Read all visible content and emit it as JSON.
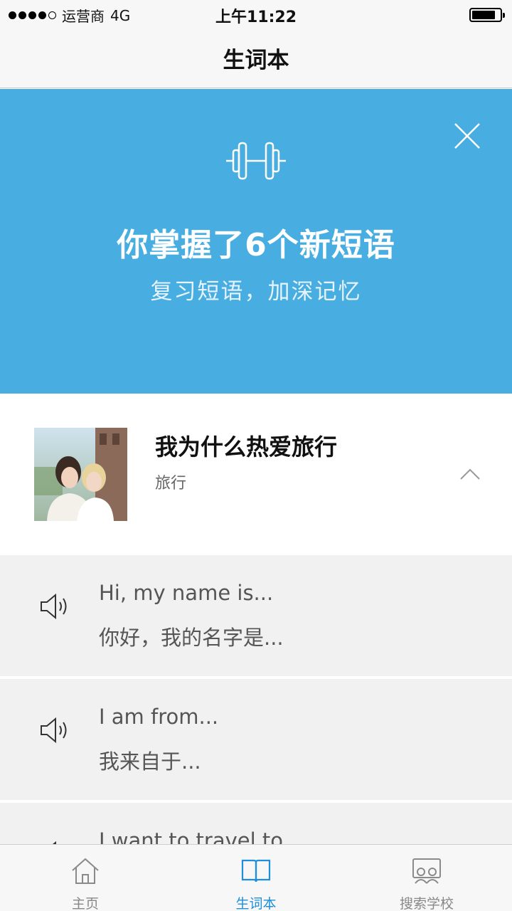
{
  "status_bar": {
    "carrier": "运营商",
    "network": "4G",
    "time": "上午11:22",
    "signal_bars": 4,
    "battery_level": 0.85
  },
  "nav": {
    "title": "生词本"
  },
  "banner": {
    "icon": "dumbbell-icon",
    "title": "你掌握了6个新短语",
    "subtitle": "复习短语，加深记忆",
    "bg_color": "#48aee2"
  },
  "lesson": {
    "title": "我为什么热爱旅行",
    "tag": "旅行"
  },
  "phrases": [
    {
      "en": "Hi, my name is...",
      "zh": "你好，我的名字是..."
    },
    {
      "en": "I am from...",
      "zh": "我来自于..."
    },
    {
      "en": "I want to travel to...",
      "zh": ""
    }
  ],
  "tabs": [
    {
      "label": "主页",
      "icon": "home-icon",
      "active": false
    },
    {
      "label": "生词本",
      "icon": "book-icon",
      "active": true
    },
    {
      "label": "搜索学校",
      "icon": "school-icon",
      "active": false
    }
  ],
  "colors": {
    "accent": "#1e8fd8",
    "banner": "#48aee2",
    "row_bg": "#f1f1f1"
  }
}
